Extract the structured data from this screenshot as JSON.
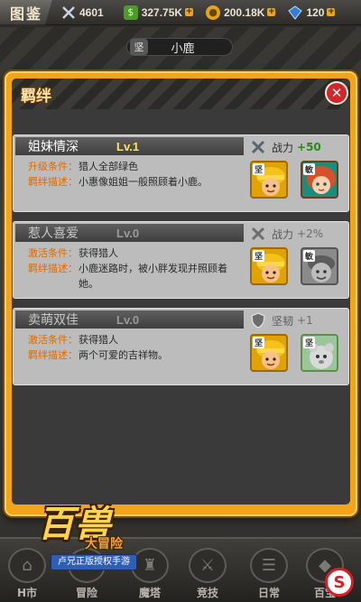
{
  "topbar": {
    "title": "图鉴",
    "resources": [
      {
        "icon": "crossed-swords-icon",
        "value": "4601",
        "has_plus": false
      },
      {
        "icon": "cash-icon",
        "value": "327.75K",
        "has_plus": true
      },
      {
        "icon": "coin-icon",
        "value": "200.18K",
        "has_plus": true
      },
      {
        "icon": "gem-icon",
        "value": "120",
        "has_plus": true
      }
    ]
  },
  "character": {
    "badge": "坚",
    "name": "小鹿"
  },
  "dialog": {
    "title": "羁绊",
    "close_label": "✕"
  },
  "bonds": [
    {
      "name": "姐妹情深",
      "level": "Lv.1",
      "locked": false,
      "condition_label": "升级条件：",
      "condition": "猎人全部绿色",
      "description_label": "羁绊描述：",
      "description": "小惠像姐姐一般照顾着小鹿。",
      "bonus_icon": "crossed-swords-icon",
      "bonus_label": "战力",
      "bonus_value": "+50",
      "avatars": [
        {
          "tag": "坚",
          "style": "hunter"
        },
        {
          "tag": "敏",
          "style": "lu"
        }
      ]
    },
    {
      "name": "惹人喜爱",
      "level": "Lv.0",
      "locked": true,
      "condition_label": "激活条件：",
      "condition": "获得猎人",
      "description_label": "羁绊描述：",
      "description": "小鹿迷路时，被小胖发现并照顾着她。",
      "bonus_icon": "crossed-swords-icon",
      "bonus_label": "战力",
      "bonus_value": "+2%",
      "avatars": [
        {
          "tag": "坚",
          "style": "hunter"
        },
        {
          "tag": "敏",
          "style": "gray"
        }
      ]
    },
    {
      "name": "卖萌双佳",
      "level": "Lv.0",
      "locked": true,
      "condition_label": "激活条件：",
      "condition": "获得猎人",
      "description_label": "羁绊描述：",
      "description": "两个可爱的吉祥物。",
      "bonus_icon": "shield-icon",
      "bonus_label": "坚韧",
      "bonus_value": "+1",
      "avatars": [
        {
          "tag": "坚",
          "style": "hunter"
        },
        {
          "tag": "坚",
          "style": "mascot"
        }
      ]
    }
  ],
  "dock": {
    "items": [
      "H市",
      "冒险",
      "魔塔",
      "竞技",
      "日常",
      "百宝"
    ]
  },
  "logo": {
    "main": "百兽大冒险",
    "sub": "大冒险",
    "banner": "卢兄正版授权手游"
  },
  "colors": {
    "dialog_orange": "#f3a41a",
    "label_orange": "#e06a00",
    "bonus_green": "#2a8a18",
    "level_yellow": "#ffe35a",
    "close_red": "#d3262a"
  }
}
